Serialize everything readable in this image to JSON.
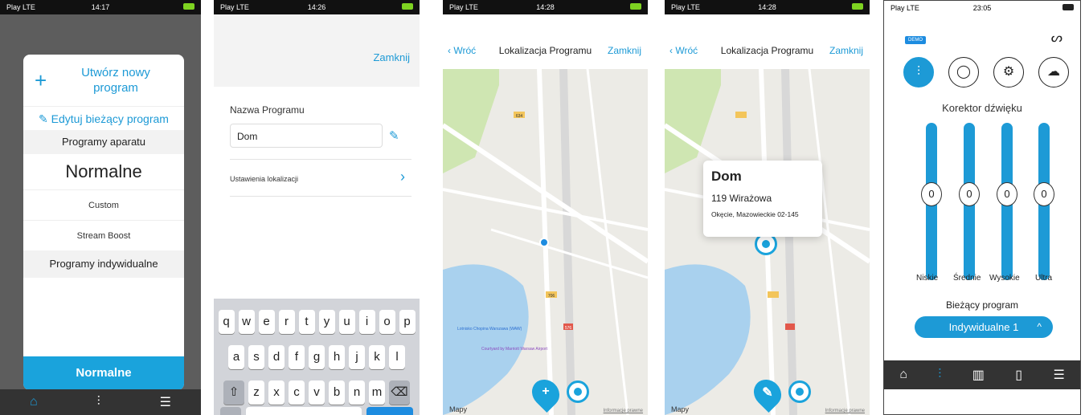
{
  "screen1": {
    "status": {
      "signal": "Play LTE",
      "time": "14:17"
    },
    "create_label": "Utwórz nowy program",
    "edit_label": "Edytuj bieżący program",
    "group_device": "Programy aparatu",
    "item_normal": "Normalne",
    "item_custom": "Custom",
    "item_stream": "Stream Boost",
    "group_individual": "Programy indywidualne",
    "selected_button": "Normalne"
  },
  "screen2": {
    "status": {
      "signal": "Play LTE",
      "time": "14:26"
    },
    "close_label": "Zamknij",
    "name_label": "Nazwa Programu",
    "name_value": "Dom",
    "location_settings": "Ustawienia lokalizacji",
    "keyboard_rows": [
      [
        "q",
        "w",
        "e",
        "r",
        "t",
        "y",
        "u",
        "i",
        "o",
        "p"
      ],
      [
        "a",
        "s",
        "d",
        "f",
        "g",
        "h",
        "j",
        "k",
        "l"
      ],
      [
        "⇧",
        "z",
        "x",
        "c",
        "v",
        "b",
        "n",
        "m",
        "⌫"
      ]
    ]
  },
  "screen3": {
    "status": {
      "signal": "Play LTE",
      "time": "14:28"
    },
    "back_label": "Wróć",
    "title": "Lokalizacja Programu",
    "close_label": "Zamknij",
    "map_labels": {
      "r634": "634",
      "r706": "706",
      "r576": "576",
      "airport": "Lotnisko Chopina Warszawa (WAW)",
      "courtyard": "Courtyard by Marriott Warsaw Airport"
    },
    "maps_brand": "Mapy",
    "legal": "Informacje prawne"
  },
  "screen4": {
    "status": {
      "signal": "Play LTE",
      "time": "14:28"
    },
    "back_label": "Wróć",
    "title": "Lokalizacja Programu",
    "close_label": "Zamknij",
    "card_name": "Dom",
    "card_address": "119 Wirażowa",
    "card_city": "Okęcie, Mazowieckie 02-145",
    "maps_brand": "Mapy",
    "legal": "Informacje prawne"
  },
  "screen5": {
    "status": {
      "signal": "Play LTE",
      "time": "23:05"
    },
    "demo_badge": "DEMO",
    "equalizer_title": "Korektor dźwięku",
    "bands": [
      {
        "label": "Niskie",
        "value": "0"
      },
      {
        "label": "Średnie",
        "value": "0"
      },
      {
        "label": "Wysokie",
        "value": "0"
      },
      {
        "label": "Ultra",
        "value": "0"
      }
    ],
    "current_label": "Bieżący program",
    "current_value": "Indywidualne 1"
  },
  "colors": {
    "accent": "#1d9ad6",
    "tabbar": "#333333"
  }
}
